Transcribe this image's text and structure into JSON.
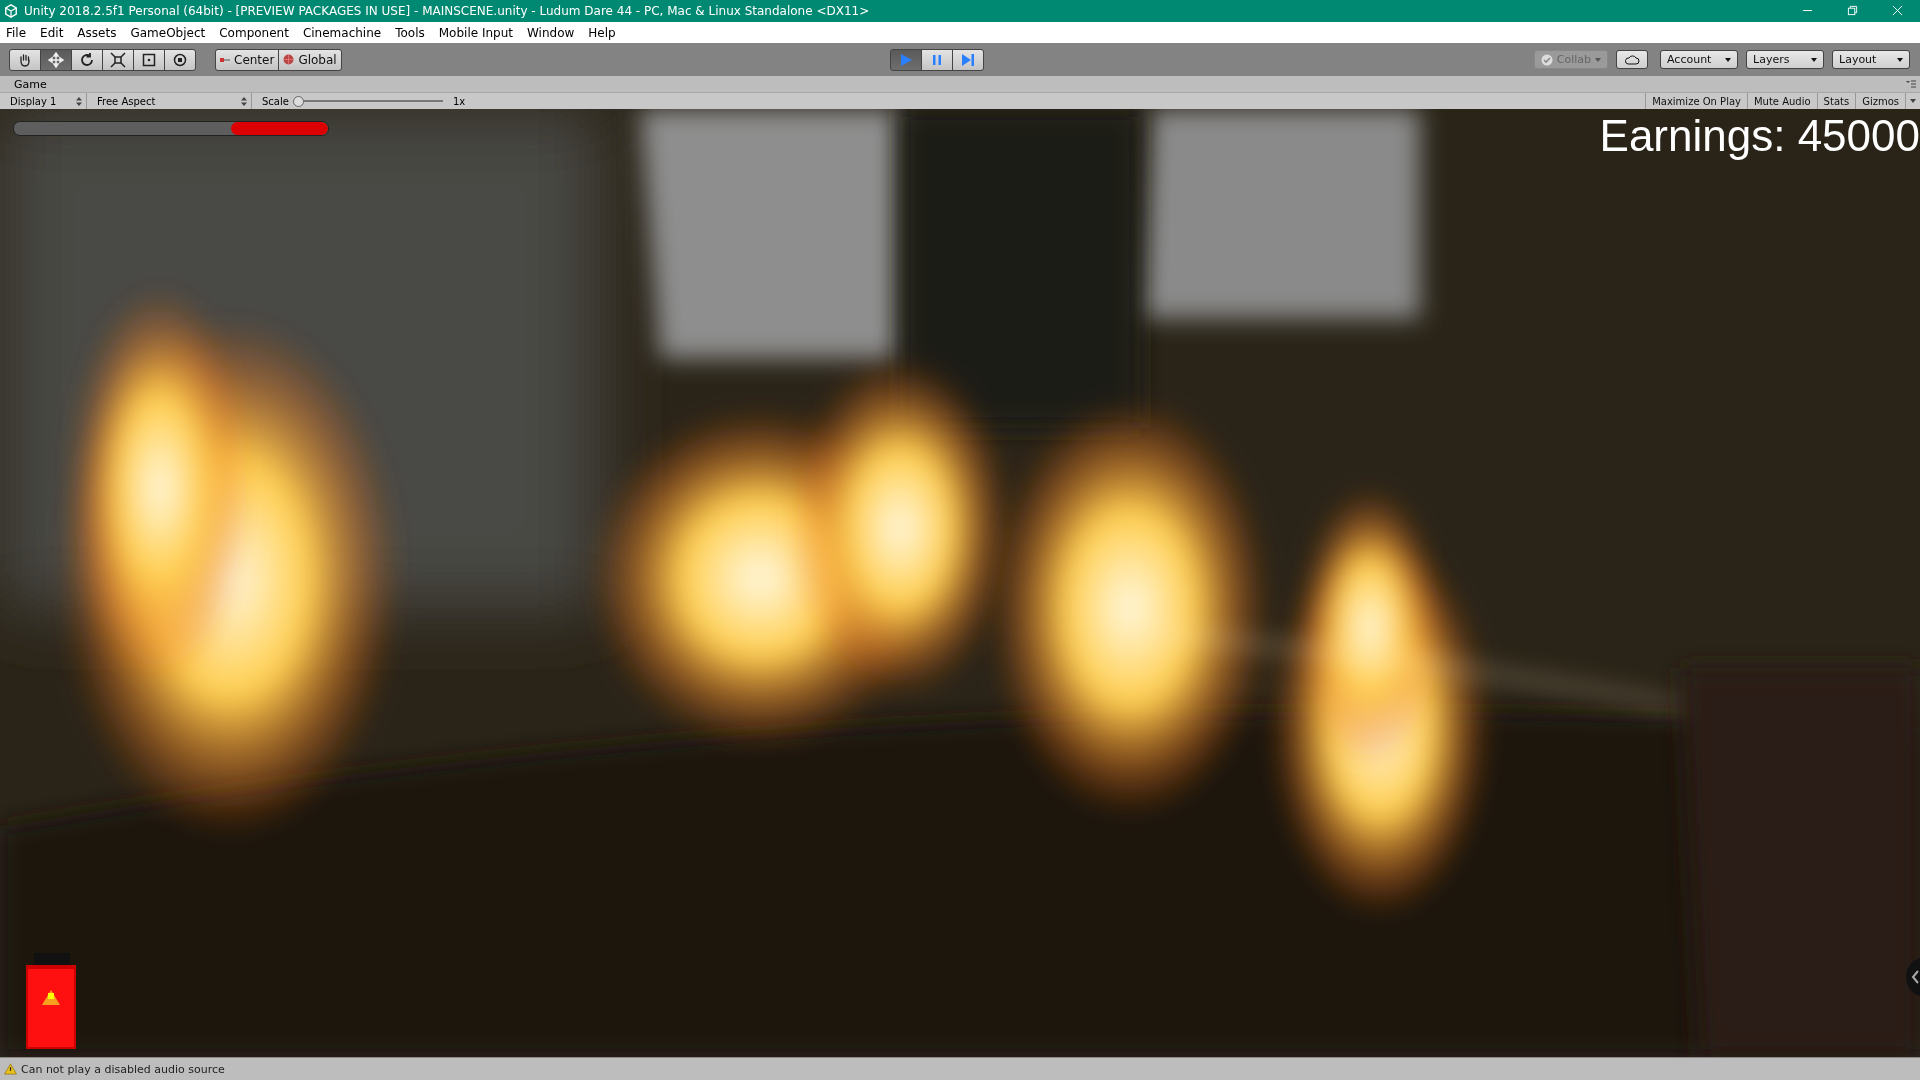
{
  "window": {
    "title": "Unity 2018.2.5f1 Personal (64bit) - [PREVIEW PACKAGES IN USE] - MAINSCENE.unity - Ludum Dare 44 - PC, Mac & Linux Standalone <DX11>"
  },
  "menu": [
    "File",
    "Edit",
    "Assets",
    "GameObject",
    "Component",
    "Cinemachine",
    "Tools",
    "Mobile Input",
    "Window",
    "Help"
  ],
  "tools": [
    {
      "kind": "hand",
      "selected": false
    },
    {
      "kind": "move",
      "selected": true
    },
    {
      "kind": "rotate",
      "selected": false
    },
    {
      "kind": "scale",
      "selected": false
    },
    {
      "kind": "rect",
      "selected": false
    },
    {
      "kind": "transform",
      "selected": false
    }
  ],
  "pivot": [
    {
      "kind": "pivot",
      "label": "Center"
    },
    {
      "kind": "space",
      "label": "Global"
    }
  ],
  "playback": [
    {
      "kind": "play",
      "selected": true
    },
    {
      "kind": "pause",
      "selected": false
    },
    {
      "kind": "step",
      "selected": false
    }
  ],
  "right_toolbar": [
    {
      "kind": "collab",
      "label": "Collab",
      "disabled": true
    },
    {
      "kind": "cloud",
      "disabled": false
    },
    {
      "kind": "dropdown",
      "label": "Account",
      "disabled": false
    },
    {
      "kind": "dropdown",
      "label": "Layers",
      "disabled": false
    },
    {
      "kind": "dropdown",
      "label": "Layout",
      "disabled": false
    }
  ],
  "game_tab": {
    "title": "Game"
  },
  "game_toolbar": {
    "display": "Display 1",
    "aspect": "Free Aspect",
    "scale_label": "Scale",
    "scale": {
      "level": 0.0
    },
    "scale_reading": "1x",
    "toggles": [
      {
        "label": "Maximize On Play",
        "on": false
      },
      {
        "label": "Mute Audio",
        "on": false
      },
      {
        "label": "Stats",
        "on": false
      },
      {
        "label": "Gizmos",
        "on": false
      }
    ]
  },
  "game_view": {
    "health": {
      "level": 0.31
    },
    "earnings": "Earnings: 45000"
  },
  "status_bar": {
    "message": "Can not play a disabled audio source"
  }
}
